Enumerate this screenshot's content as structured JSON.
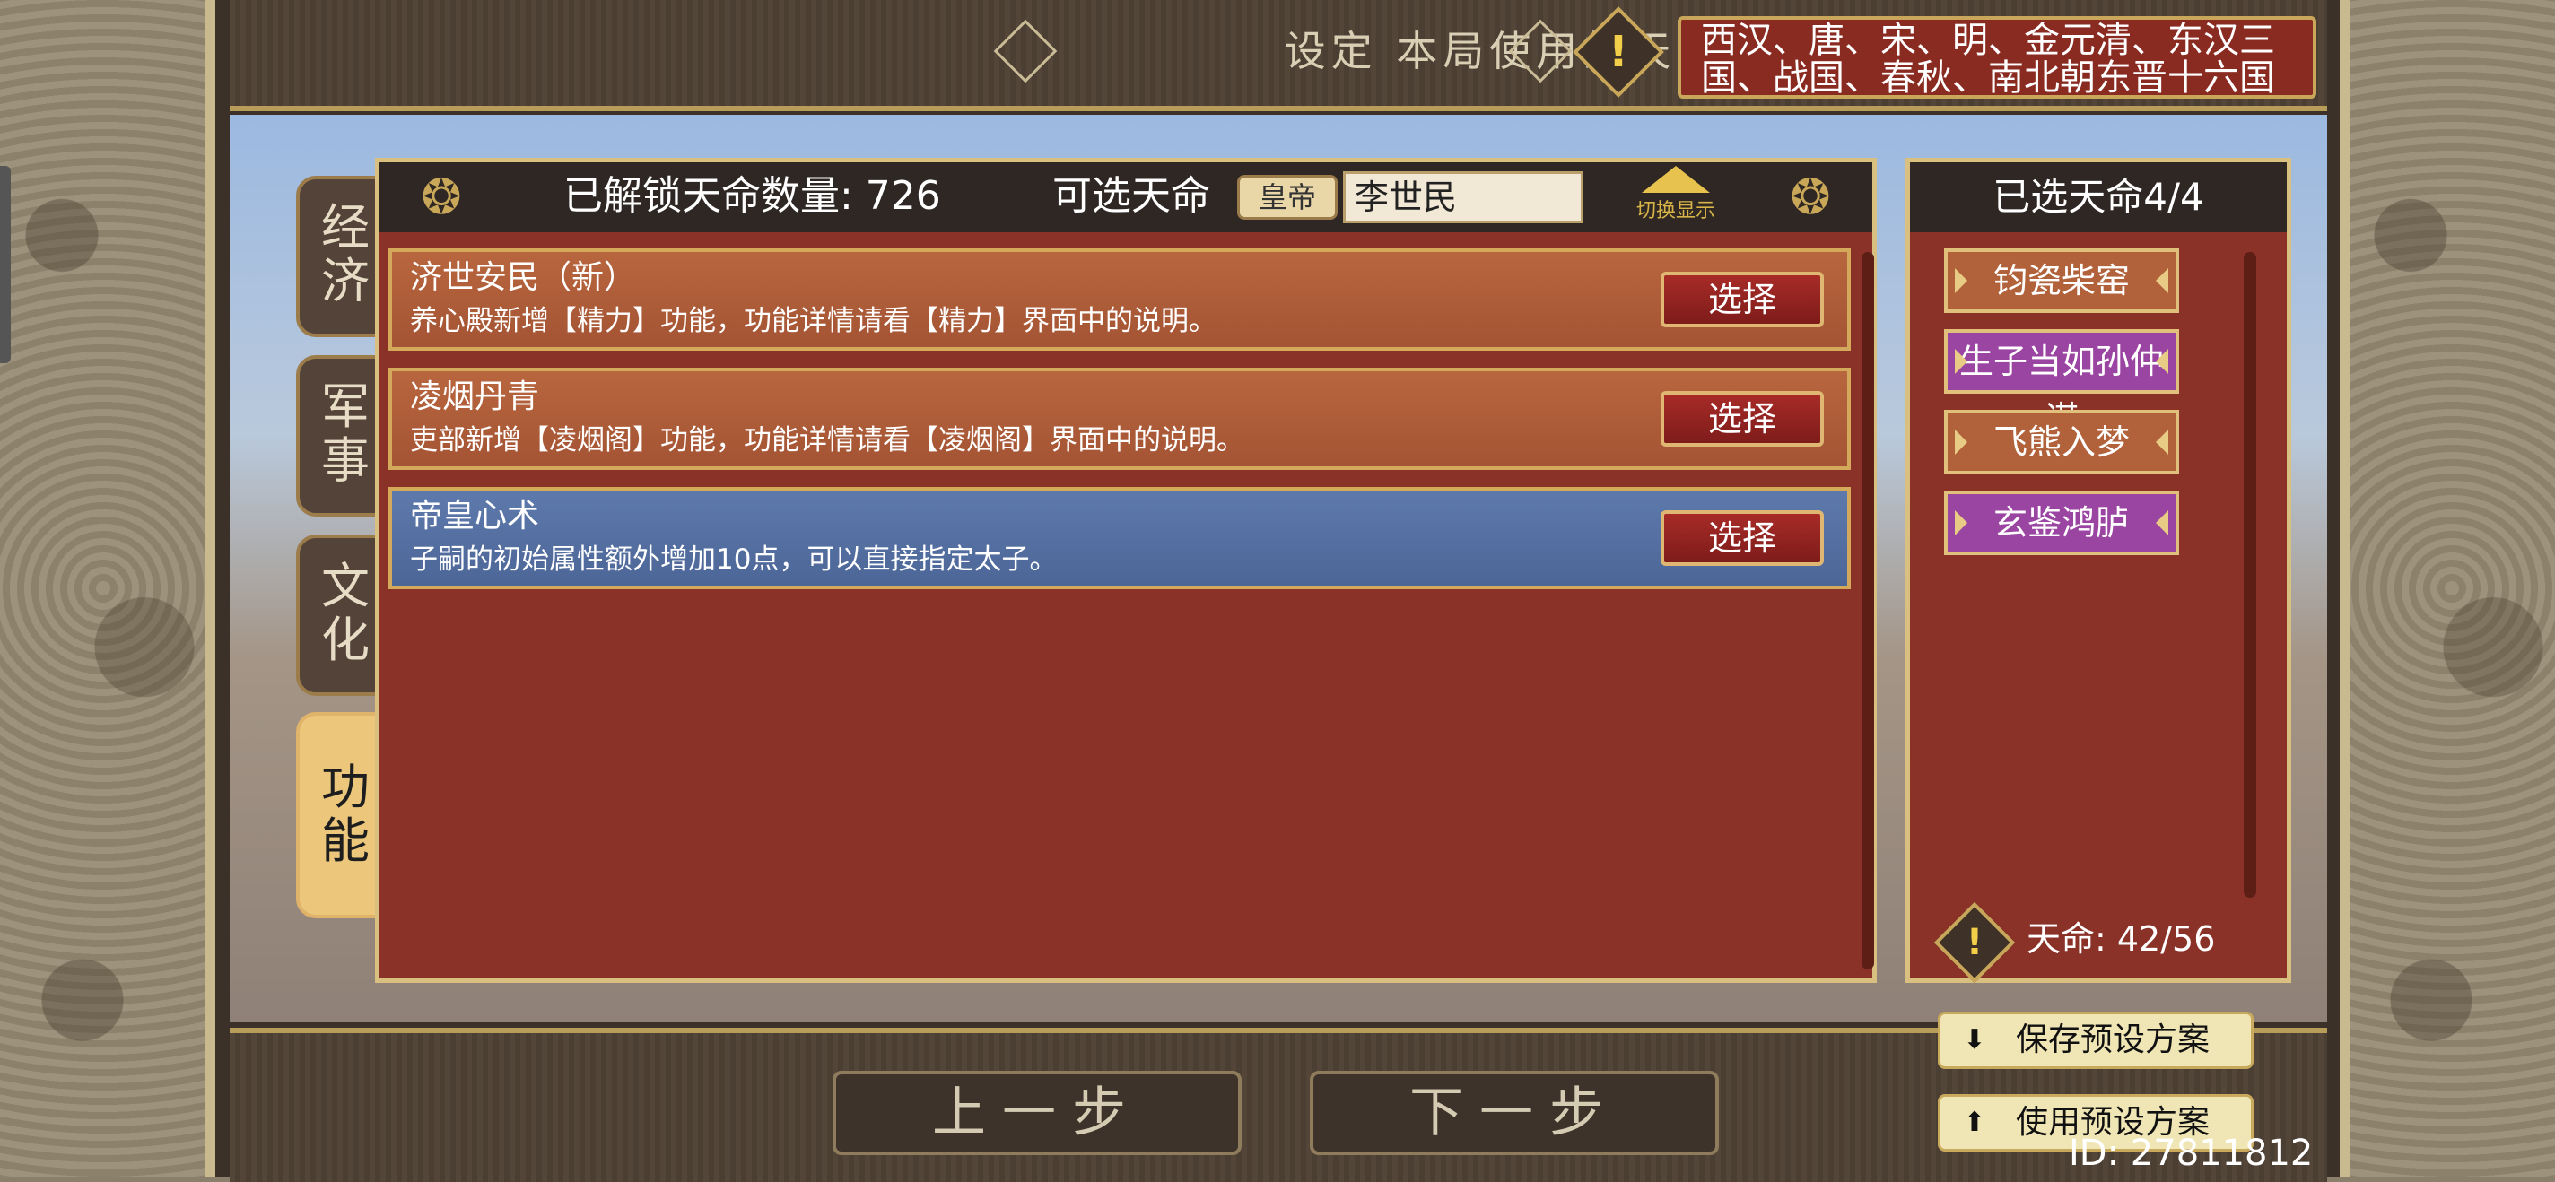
{
  "header": {
    "title": "设定 本局使用的天命",
    "dynasties": "西汉、唐、宋、明、金元清、东汉三国、战国、春秋、南北朝东晋十六国"
  },
  "categories": [
    {
      "label": "经济"
    },
    {
      "label": "军事"
    },
    {
      "label": "文化"
    },
    {
      "label": "功能"
    }
  ],
  "main_panel": {
    "unlocked_label": "已解锁天命数量: 726",
    "selectable_label": "可选天命",
    "emperor_button": "皇帝",
    "search_value": "李世民",
    "toggle_label": "切换显示",
    "items": [
      {
        "name": "济世安民（新）",
        "desc": "养心殿新增【精力】功能，功能详情请看【精力】界面中的说明。",
        "button": "选择"
      },
      {
        "name": "凌烟丹青",
        "desc": "吏部新增【凌烟阁】功能，功能详情请看【凌烟阁】界面中的说明。",
        "button": "选择"
      },
      {
        "name": "帝皇心术",
        "desc": "子嗣的初始属性额外增加10点，可以直接指定太子。",
        "button": "选择"
      }
    ]
  },
  "selected_panel": {
    "title": "已选天命4/4",
    "items": [
      {
        "label": "钧瓷柴窑"
      },
      {
        "label": "生子当如孙仲谋"
      },
      {
        "label": "飞熊入梦"
      },
      {
        "label": "玄鉴鸿胪"
      }
    ],
    "tianming": "天命: 42/56"
  },
  "footer": {
    "prev": "上一步",
    "next": "下一步",
    "save_preset": "保存预设方案",
    "use_preset": "使用预设方案",
    "id_text": "ID: 27811812"
  },
  "colors": {
    "panel_red": "#8a3228",
    "item_orange": "#b8663e",
    "item_active_blue": "#5e79ab",
    "chosen_purple": "#9b45a3",
    "gold": "#d9c080"
  }
}
